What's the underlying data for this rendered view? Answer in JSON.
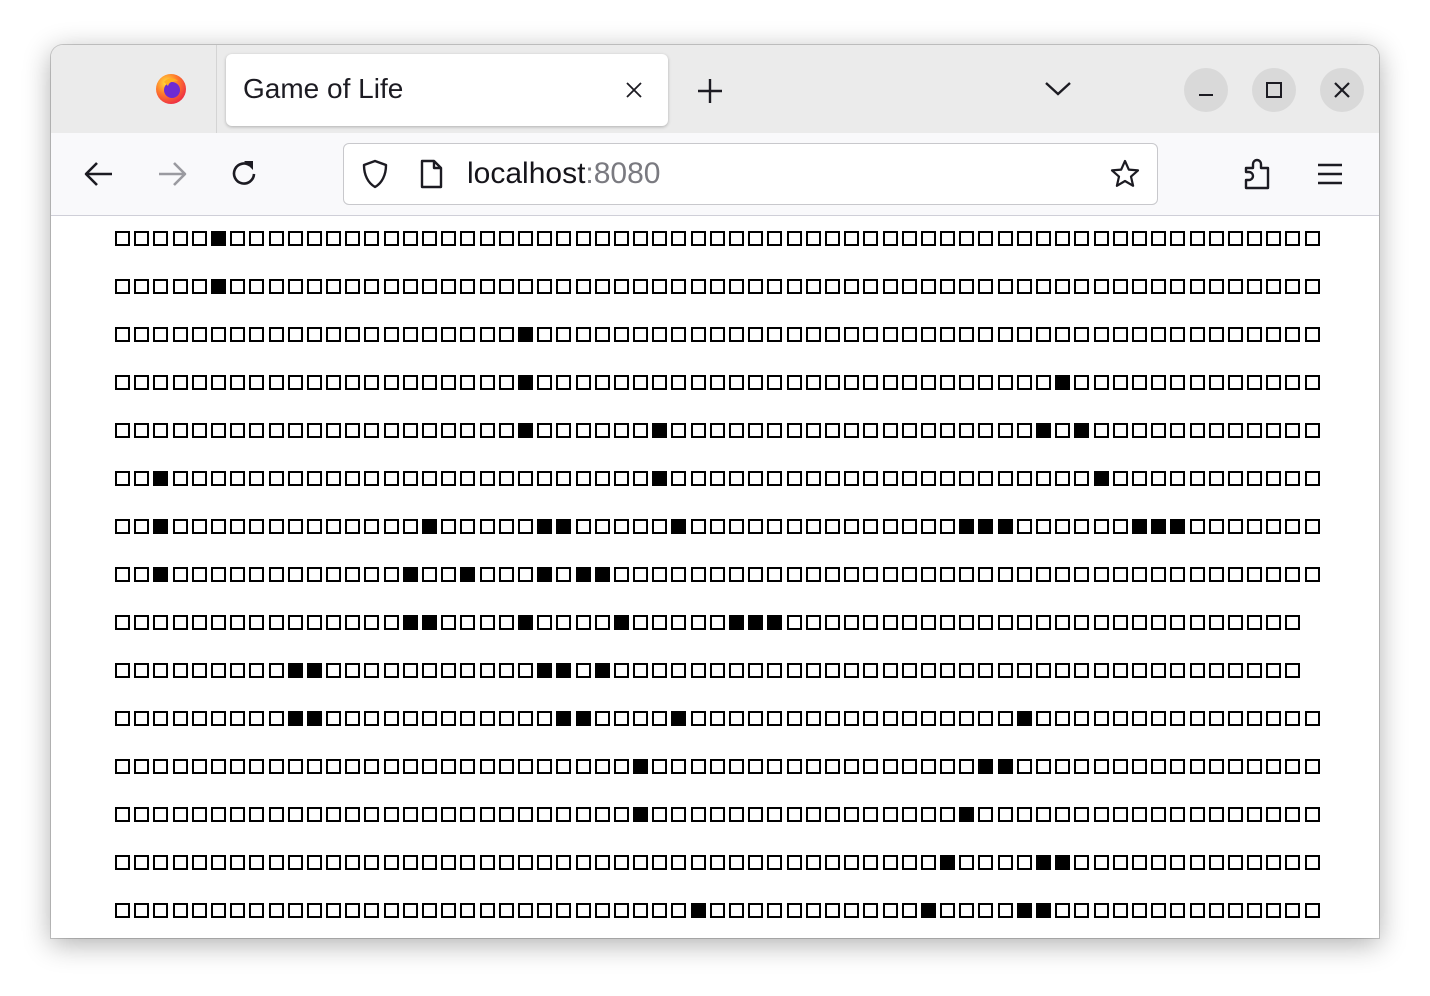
{
  "browser": {
    "tab_title": "Game of Life",
    "url_host": "localhost",
    "url_port": ":8080",
    "icons": [
      "firefox-logo",
      "close-icon",
      "plus-icon",
      "chevron-down-icon",
      "minimize-icon",
      "maximize-icon",
      "close-icon",
      "back-arrow-icon",
      "forward-arrow-icon",
      "reload-icon",
      "shield-icon",
      "page-icon",
      "star-icon",
      "extensions-icon",
      "menu-icon"
    ]
  },
  "board": {
    "columns": 65,
    "dead_symbol": "□",
    "alive_symbol": "■",
    "rows": [
      "□□□□□■□□□□□□□□□□□□□□□□□□□□□□□□□□□□□□□□□□□□□□□□□□□□□□□□□□□□□□□□□",
      "□□□□□■□□□□□□□□□□□□□□□□□□□□□□□□□□□□□□□□□□□□□□□□□□□□□□□□□□□□□□□□□",
      "□□□□□□□□□□□□□□□□□□□□□■□□□□□□□□□□□□□□□□□□□□□□□□□□□□□□□□□□□□□□□□□",
      "□□□□□□□□□□□□□□□□□□□□□■□□□□□□□□□□□□□□□□□□□□□□□□□□□■□□□□□□□□□□□□□",
      "□□□□□□□□□□□□□□□□□□□□□■□□□□□□■□□□□□□□□□□□□□□□□□□□■□■□□□□□□□□□□□□",
      "□□■□□□□□□□□□□□□□□□□□□□□□□□□□■□□□□□□□□□□□□□□□□□□□□□□■□□□□□□□□□□□",
      "□□■□□□□□□□□□□□□□■□□□□□■■□□□□□■□□□□□□□□□□□□□□■■■□□□□□□■■■□□□□□□□",
      "□□■□□□□□□□□□□□□■□□■□□□■□■■□□□□□□□□□□□□□□□□□□□□□□□□□□□□□□□□□□□□□",
      "□□□□□□□□□□□□□□□■■□□□□■□□□□■□□□□□■■■□□□□□□□□□□□□□□□□□□□□□□□□□□□",
      "□□□□□□□□□■■□□□□□□□□□□□■■□■□□□□□□□□□□□□□□□□□□□□□□□□□□□□□□□□□□□□",
      "□□□□□□□□□■■□□□□□□□□□□□□■■□□□□■□□□□□□□□□□□□□□□□□■□□□□□□□□□□□□□□□",
      "□□□□□□□□□□□□□□□□□□□□□□□□□□□■□□□□□□□□□□□□□□□□□■■□□□□□□□□□□□□□□□□",
      "□□□□□□□□□□□□□□□□□□□□□□□□□□□■□□□□□□□□□□□□□□□□■□□□□□□□□□□□□□□□□□□",
      "□□□□□□□□□□□□□□□□□□□□□□□□□□□□□□□□□□□□□□□□□□□■□□□□■■□□□□□□□□□□□□□",
      "□□□□□□□□□□□□□□□□□□□□□□□□□□□□□□■□□□□□□□□□□□■□□□□■■□□□□□□□□□□□□□□"
    ]
  }
}
